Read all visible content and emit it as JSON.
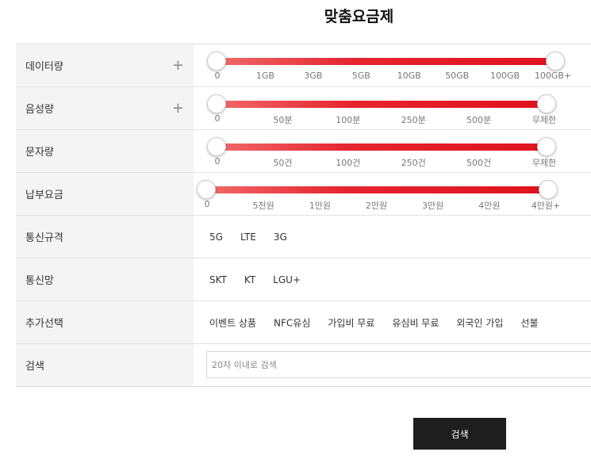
{
  "page_title": "맞춤요금제",
  "rows": {
    "data": {
      "label": "데이터량",
      "plus": "+",
      "ticks": [
        "0",
        "1GB",
        "3GB",
        "5GB",
        "10GB",
        "50GB",
        "100GB",
        "100GB+"
      ],
      "range": {
        "min_index": 0,
        "max_index": 7
      }
    },
    "voice": {
      "label": "음성량",
      "plus": "+",
      "ticks": [
        "0",
        "50분",
        "100분",
        "250분",
        "500분",
        "무제한"
      ],
      "range": {
        "min_index": 0,
        "max_index": 5
      }
    },
    "sms": {
      "label": "문자량",
      "ticks": [
        "0",
        "50건",
        "100건",
        "250건",
        "500건",
        "무제한"
      ],
      "range": {
        "min_index": 0,
        "max_index": 5
      }
    },
    "fee": {
      "label": "납부요금",
      "ticks": [
        "0",
        "5천원",
        "1만원",
        "2만원",
        "3만원",
        "4만원",
        "4만원+"
      ],
      "range": {
        "min_index": 0,
        "max_index": 6
      }
    },
    "network_type": {
      "label": "통신규격",
      "options": [
        "5G",
        "LTE",
        "3G"
      ]
    },
    "carrier": {
      "label": "통신망",
      "options": [
        "SKT",
        "KT",
        "LGU+"
      ]
    },
    "extra": {
      "label": "추가선택",
      "options": [
        "이벤트 상품",
        "NFC유심",
        "가입비 무료",
        "유심비 무료",
        "외국인 가입",
        "선불"
      ]
    },
    "search": {
      "label": "검색",
      "value": "",
      "placeholder": "20자 이내로 검색"
    }
  },
  "search_button": "검색",
  "colors": {
    "slider": "#e0121d",
    "button": "#1e1e1e"
  }
}
